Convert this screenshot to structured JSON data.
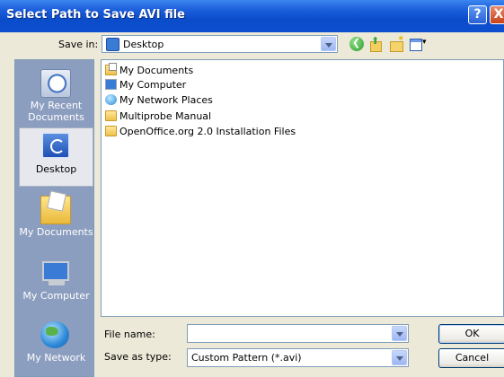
{
  "window": {
    "title": "Select Path to Save AVI file"
  },
  "title_buttons": {
    "help": "?",
    "close": "X"
  },
  "save_in": {
    "label": "Save in:",
    "value": "Desktop"
  },
  "toolbar": {
    "icons": [
      "back-icon",
      "up-folder-icon",
      "new-folder-icon",
      "views-menu-icon"
    ]
  },
  "places": [
    {
      "label": "My Recent Documents",
      "icon": "recent-documents-icon",
      "selected": false
    },
    {
      "label": "Desktop",
      "icon": "desktop-icon",
      "selected": true
    },
    {
      "label": "My Documents",
      "icon": "my-documents-icon",
      "selected": false
    },
    {
      "label": "My Computer",
      "icon": "my-computer-icon",
      "selected": false
    },
    {
      "label": "My Network",
      "icon": "my-network-icon",
      "selected": false
    }
  ],
  "files": [
    {
      "name": "My Documents",
      "icon": "documents-folder-icon"
    },
    {
      "name": "My Computer",
      "icon": "computer-icon"
    },
    {
      "name": "My Network Places",
      "icon": "network-places-icon"
    },
    {
      "name": "Multiprobe Manual",
      "icon": "folder-icon"
    },
    {
      "name": "OpenOffice.org 2.0 Installation Files",
      "icon": "folder-icon"
    }
  ],
  "file_name": {
    "label": "File name:",
    "value": ""
  },
  "save_as_type": {
    "label": "Save as type:",
    "value": "Custom Pattern (*.avi)"
  },
  "buttons": {
    "ok": "OK",
    "cancel": "Cancel"
  }
}
